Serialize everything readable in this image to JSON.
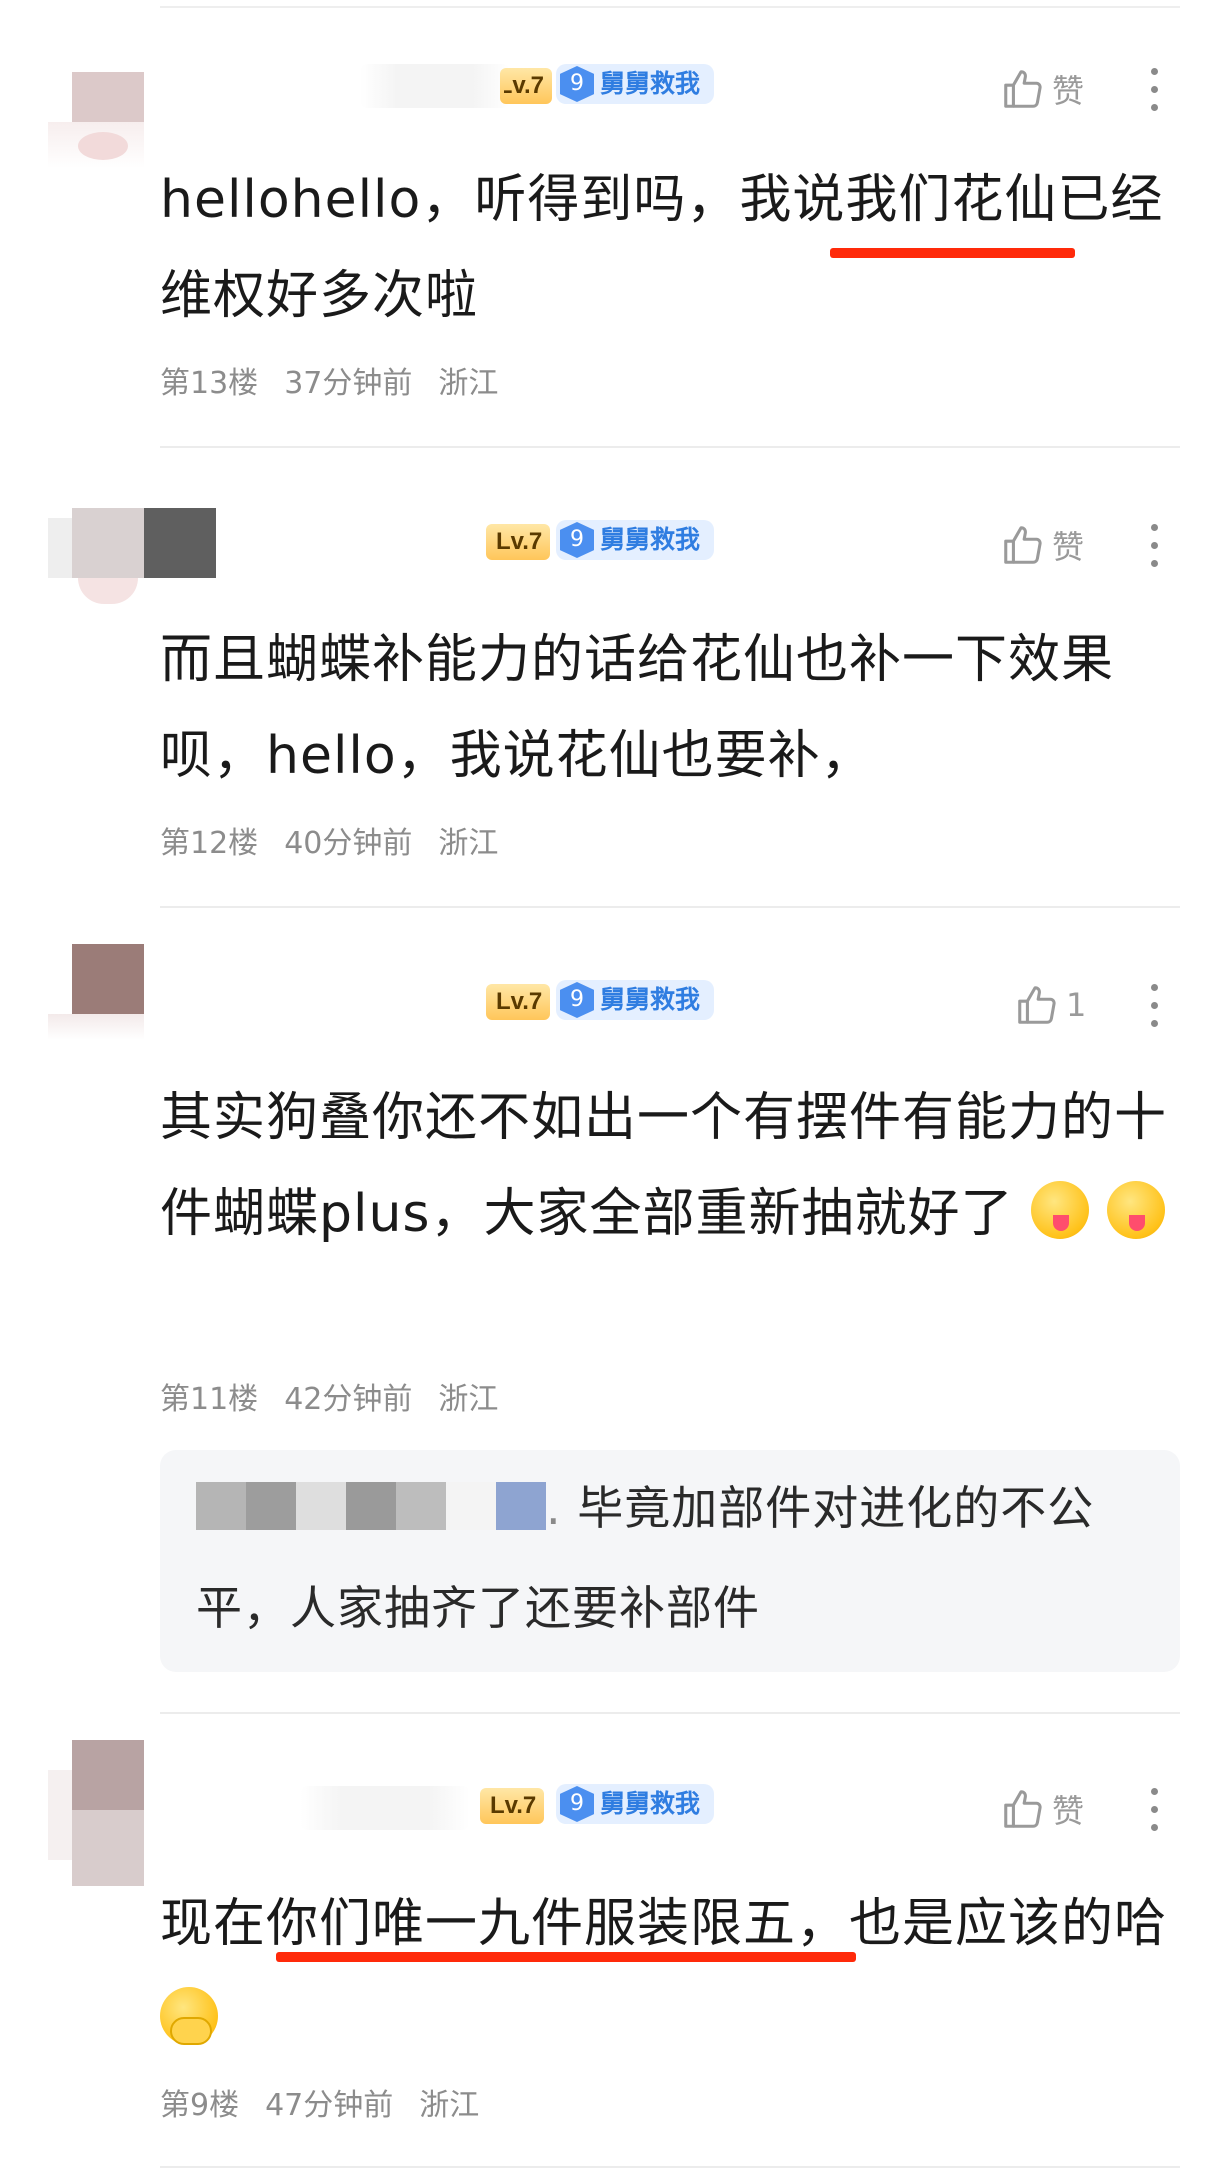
{
  "comments": [
    {
      "level": "Lv.7",
      "fan_level": "9",
      "fan_name": "舅舅救我",
      "like_label": "赞",
      "text_parts": [
        "hellohello，听得到吗，我说",
        "我们花仙",
        "已经维权好多次啦"
      ],
      "floor": "第13楼",
      "time": "37分钟前",
      "location": "浙江"
    },
    {
      "level": "Lv.7",
      "fan_level": "9",
      "fan_name": "舅舅救我",
      "like_label": "赞",
      "text": "而且蝴蝶补能力的话给花仙也补一下效果呗，hello，我说花仙也要补，",
      "floor": "第12楼",
      "time": "40分钟前",
      "location": "浙江"
    },
    {
      "level": "Lv.7",
      "fan_level": "9",
      "fan_name": "舅舅救我",
      "like_label": "1",
      "text": "其实狗叠你还不如出一个有摆件有能力的十件蝴蝶plus，大家全部重新抽就好了",
      "floor": "第11楼",
      "time": "42分钟前",
      "location": "浙江",
      "reply": {
        "text": "毕竟加部件对进化的不公平，人家抽齐了还要补部件"
      }
    },
    {
      "level": "Lv.7",
      "fan_level": "9",
      "fan_name": "舅舅救我",
      "like_label": "赞",
      "text_parts": [
        "现在",
        "你们唯一九件服装限五",
        "，也是应该的哈"
      ],
      "floor": "第9楼",
      "time": "47分钟前",
      "location": "浙江"
    }
  ],
  "icons": {
    "like": "thumbs-up-icon",
    "more": "more-vertical-icon",
    "emoji_yum": "face-savoring-food-emoji",
    "emoji_hand": "face-with-hand-over-mouth-emoji"
  },
  "colors": {
    "underline": "#ff2a0a",
    "fan_badge_text": "#2f7de1",
    "meta_text": "#8c8c8c"
  }
}
